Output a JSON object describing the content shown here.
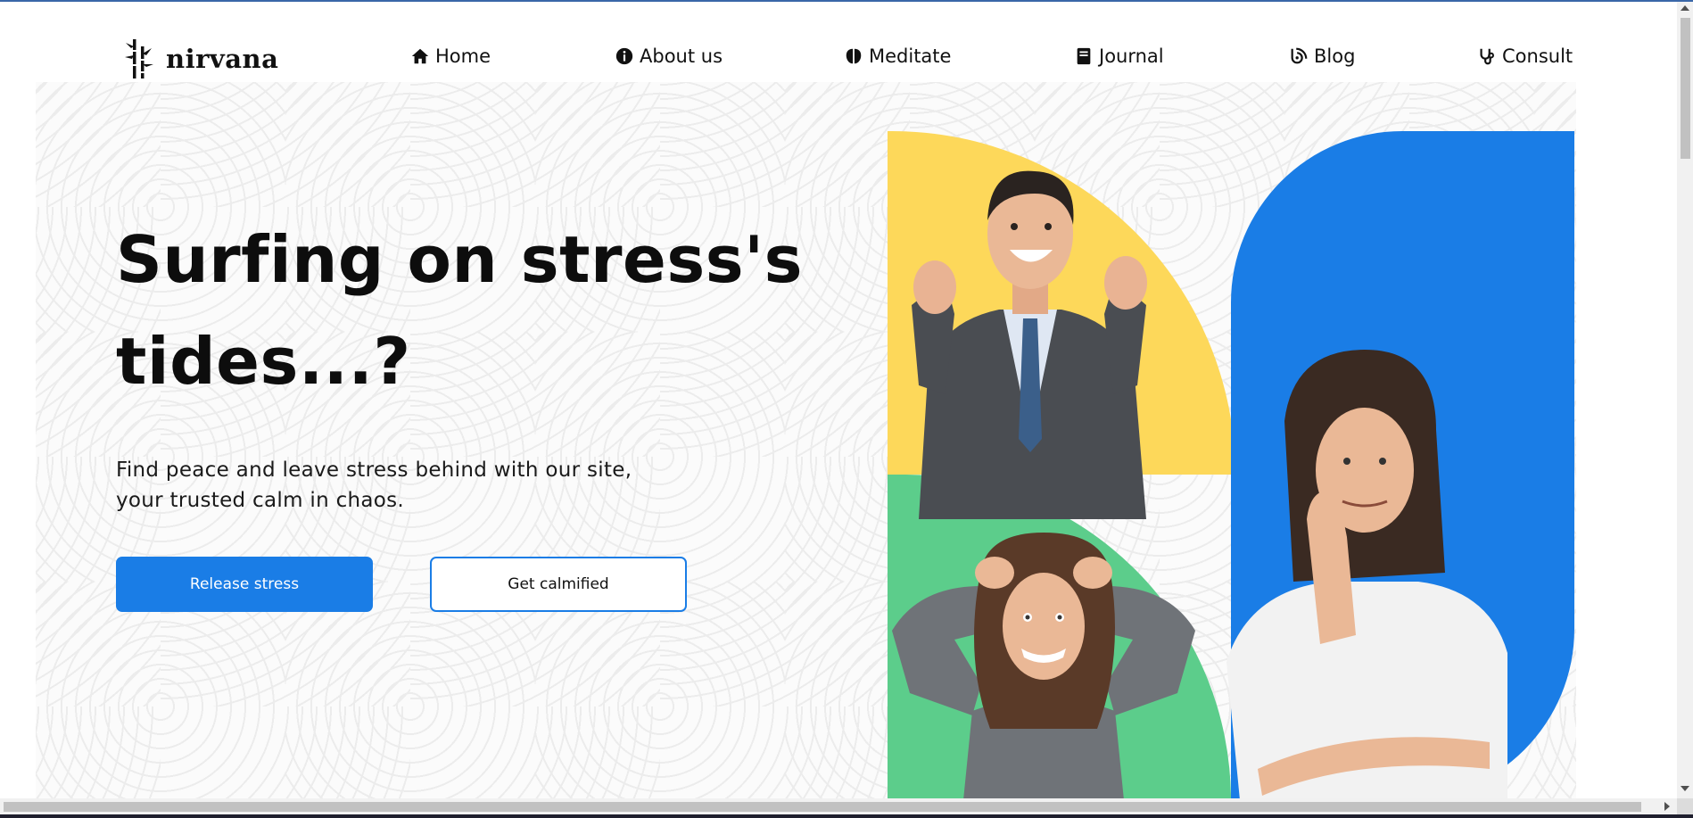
{
  "brand": {
    "name": "nirvana",
    "logo_icon": "bamboo-icon"
  },
  "nav": {
    "items": [
      {
        "label": "Home",
        "icon": "home-icon"
      },
      {
        "label": "About us",
        "icon": "info-circle-icon"
      },
      {
        "label": "Meditate",
        "icon": "brain-icon"
      },
      {
        "label": "Journal",
        "icon": "book-icon"
      },
      {
        "label": "Blog",
        "icon": "blog-icon"
      },
      {
        "label": "Consult",
        "icon": "stethoscope-icon"
      }
    ]
  },
  "hero": {
    "headline_line1": "Surfing on stress's",
    "headline_line2": "tides...?",
    "subtext_line1": "Find peace and leave stress behind with our site,",
    "subtext_line2": "your trusted calm in chaos.",
    "primary_button": "Release stress",
    "secondary_button": "Get calmified"
  },
  "colors": {
    "accent": "#1a7de6",
    "yellow_shape": "#fdd85a",
    "green_shape": "#5ccd8b",
    "blue_shape": "#1a7de6"
  }
}
